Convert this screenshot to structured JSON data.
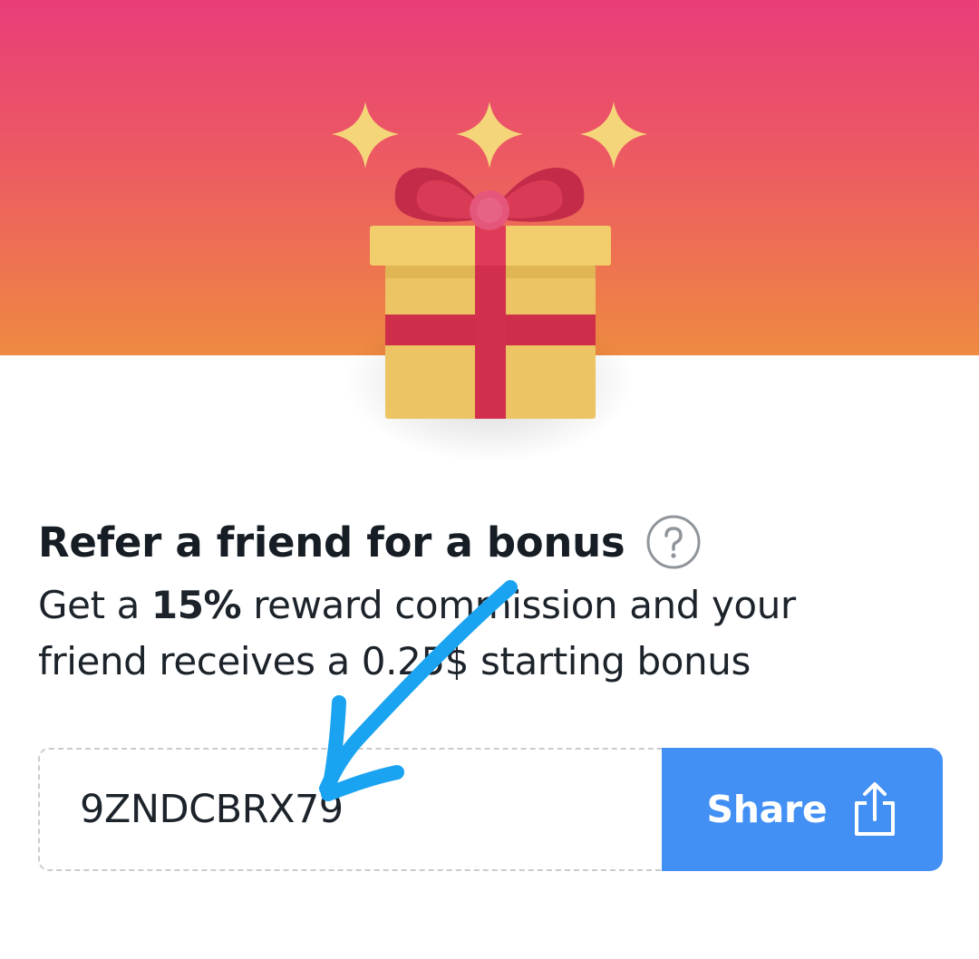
{
  "referral": {
    "title": "Refer a friend for a bonus",
    "help_icon": "question-circle-icon",
    "description_line1_prefix": "Get a ",
    "commission_percent": "15%",
    "description_line1_suffix": " reward commission and your",
    "description_line2": "friend receives a 0.25$ starting bonus",
    "code": "9ZNDCBRX79",
    "share_label": "Share",
    "share_icon": "share-upload-icon"
  },
  "illustration": {
    "icon": "gift-box-icon",
    "sparkle_icon": "sparkle-icon"
  },
  "colors": {
    "hero_top": "#e93d79",
    "hero_bottom": "#ef8a40",
    "share_button": "#4390f5",
    "annotation_arrow": "#1aa3f0",
    "text": "#161d24"
  }
}
